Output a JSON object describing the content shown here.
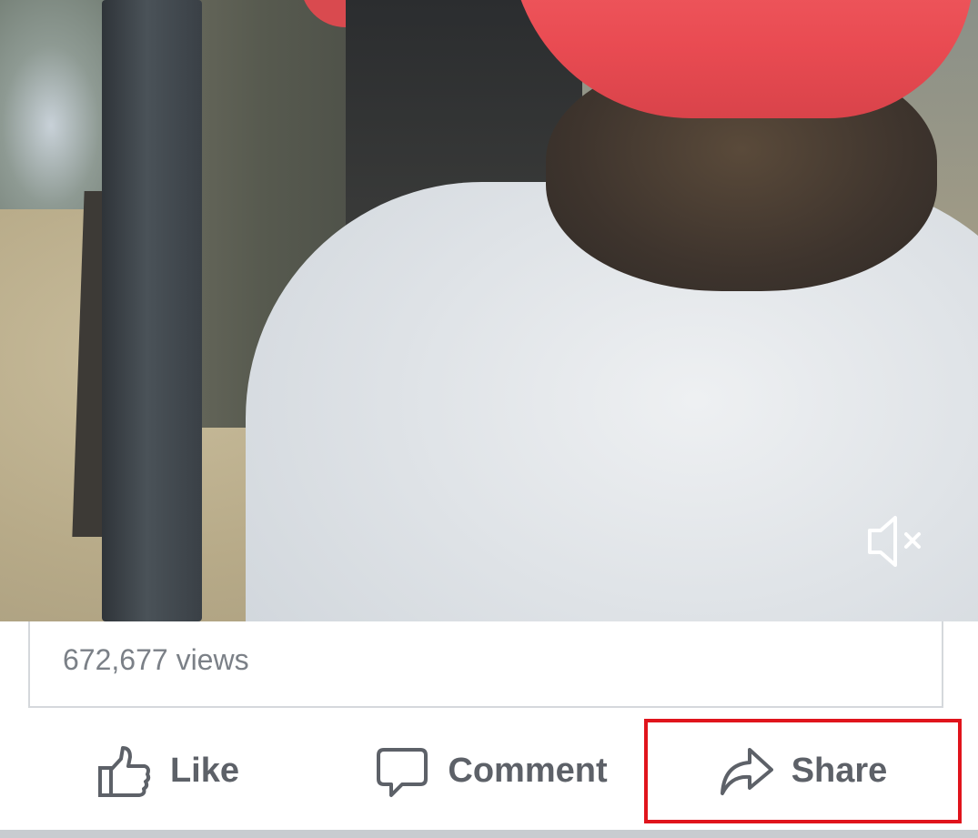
{
  "video": {
    "mute_icon": "speaker-muted-icon"
  },
  "post": {
    "views_text": "672,677 views"
  },
  "actions": {
    "like_label": "Like",
    "comment_label": "Comment",
    "share_label": "Share",
    "like_icon": "thumbs-up-icon",
    "comment_icon": "speech-bubble-icon",
    "share_icon": "share-arrow-icon",
    "highlight_color": "#e0141c"
  }
}
